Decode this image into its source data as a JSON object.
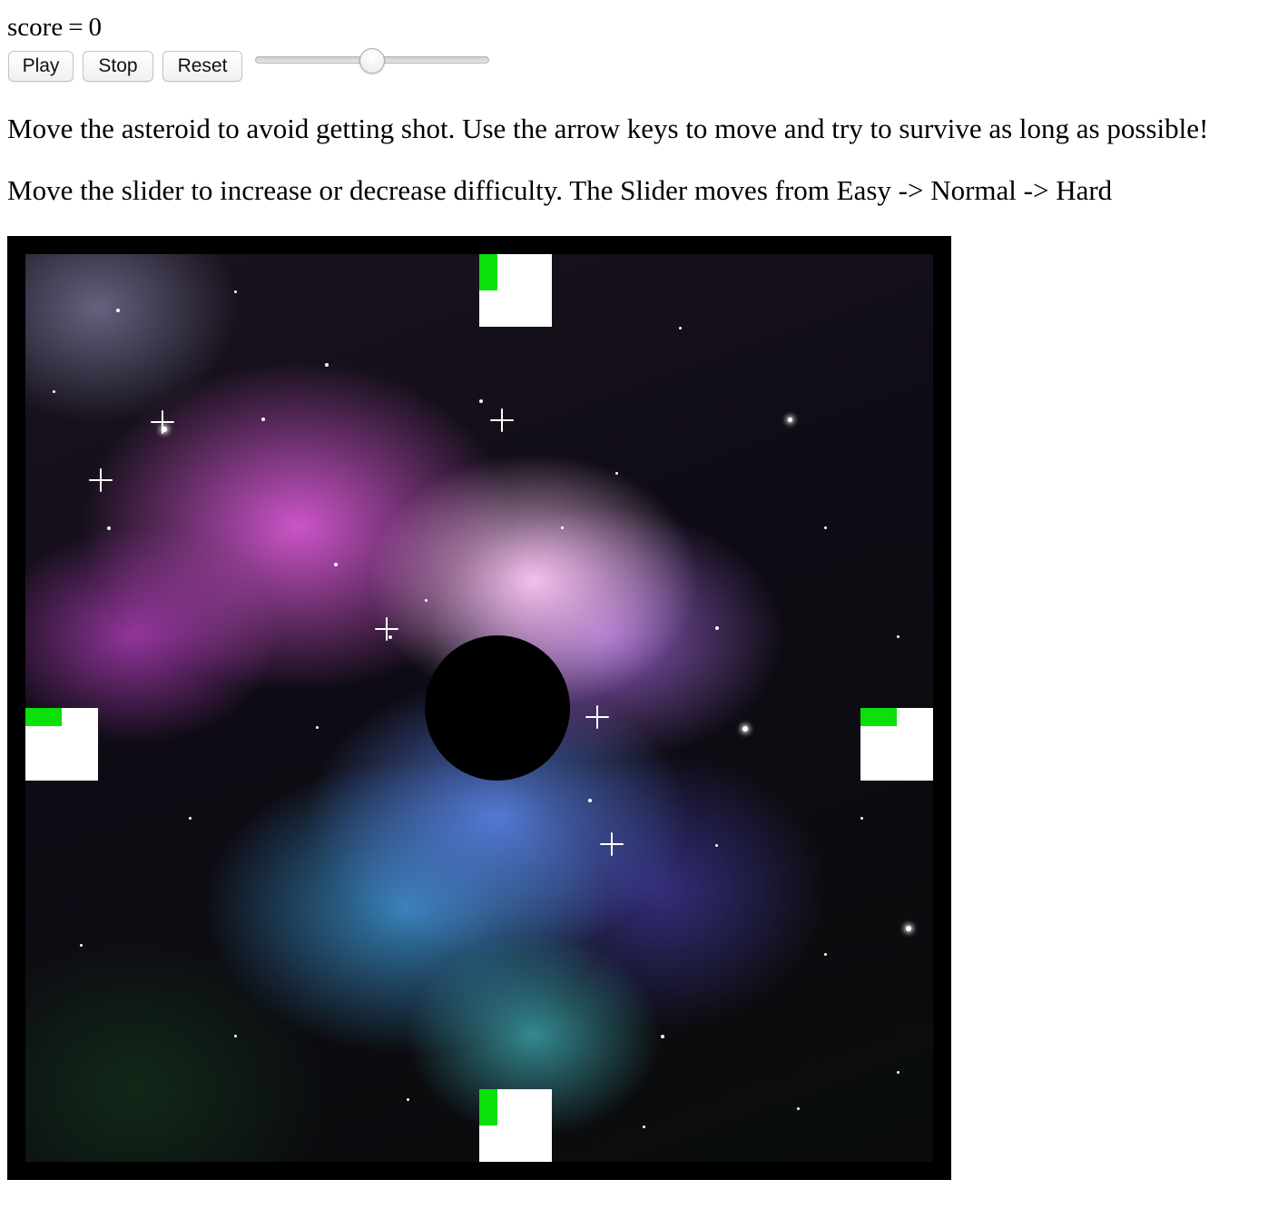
{
  "score": {
    "label": "score",
    "equals": "=",
    "value": "0"
  },
  "controls": {
    "play_label": "Play",
    "stop_label": "Stop",
    "reset_label": "Reset",
    "difficulty_slider": {
      "value_fraction": 0.5,
      "levels": [
        "Easy",
        "Normal",
        "Hard"
      ]
    }
  },
  "instructions": {
    "line1": "Move the asteroid to avoid getting shot. Use the arrow keys to move and try to survive as long as possible!",
    "line2": "Move the slider to increase or decrease difficulty. The Slider moves from Easy -> Normal -> Hard"
  },
  "game": {
    "background": "nebula space image",
    "asteroid_color": "#000000",
    "turret_color": "#ffffff",
    "barrel_color": "#0be00b",
    "frame_color": "#000000",
    "turrets": [
      "top",
      "left",
      "right",
      "bottom"
    ]
  }
}
